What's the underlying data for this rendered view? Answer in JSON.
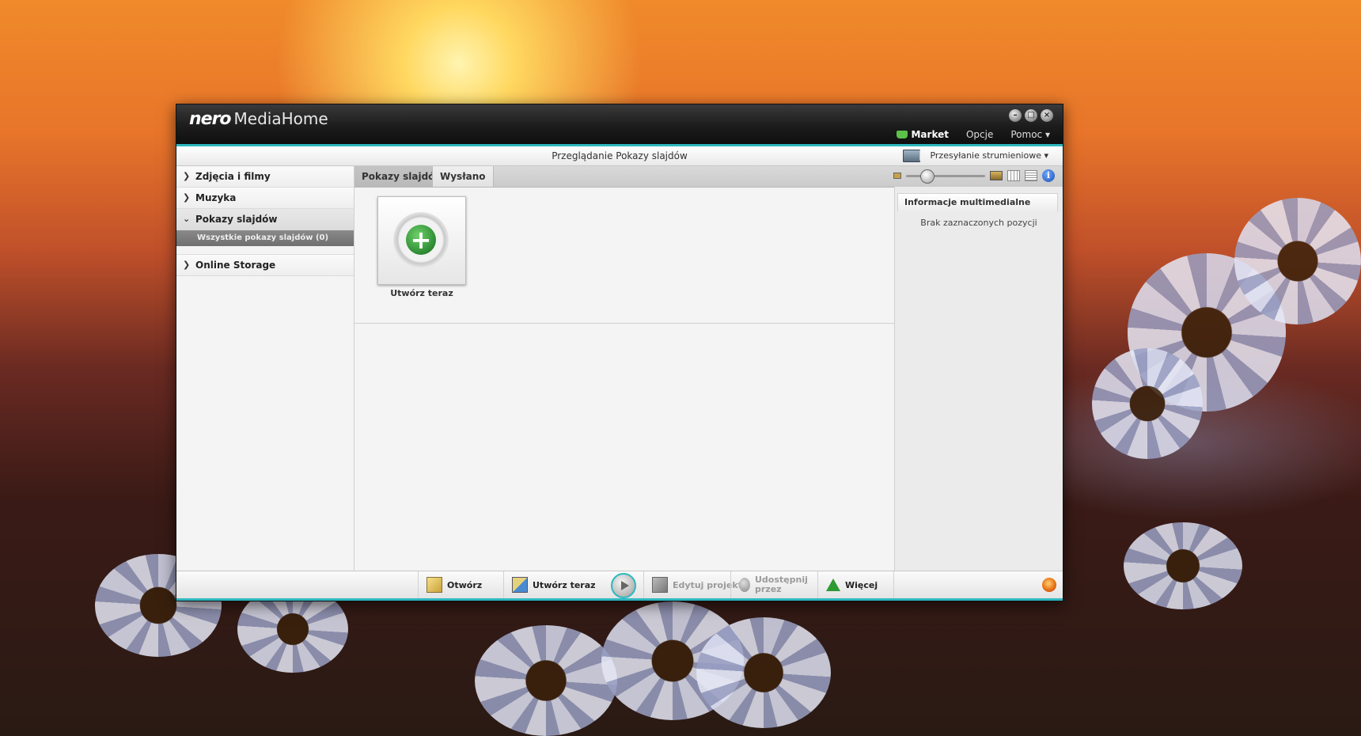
{
  "window": {
    "brand": "nero",
    "product": "MediaHome",
    "controls": [
      "minimize",
      "restore",
      "close"
    ]
  },
  "topmenu": {
    "market": "Market",
    "options": "Opcje",
    "help": "Pomoc ▾"
  },
  "viewbar": {
    "title": "Przeglądanie Pokazy slajdów",
    "streaming": "Przesyłanie strumieniowe ▾"
  },
  "sidebar": {
    "items": [
      {
        "label": "Zdjęcia i filmy",
        "expanded": false
      },
      {
        "label": "Muzyka",
        "expanded": false
      },
      {
        "label": "Pokazy slajdów",
        "expanded": true,
        "children": [
          "Wszystkie pokazy slajdów (0)"
        ]
      },
      {
        "label": "Online Storage",
        "expanded": false
      }
    ]
  },
  "tabs": {
    "slideshows": "Pokazy slajdów",
    "sent": "Wysłano",
    "active": "slideshows"
  },
  "content": {
    "create_tile_label": "Utwórz teraz"
  },
  "infopanel": {
    "title": "Informacje multimedialne",
    "empty": "Brak zaznaczonych pozycji"
  },
  "toolbar": {
    "open": "Otwórz",
    "create": "Utwórz teraz",
    "edit": "Edytuj projekt",
    "share": "Udostępnij przez",
    "more": "Więcej"
  },
  "colors": {
    "accent": "#2fb8c0",
    "titlebar": "#1c1c1c",
    "create_green": "#2c8a32"
  }
}
